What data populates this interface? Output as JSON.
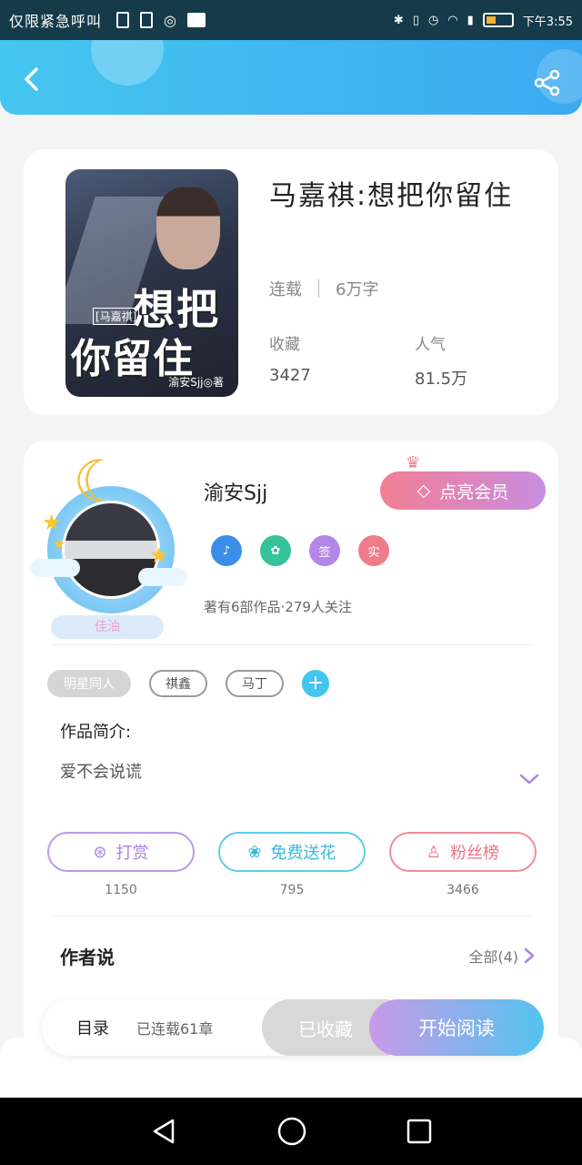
{
  "status_bar": {
    "carrier": "仅限紧急呼叫",
    "time": "下午3:55"
  },
  "header": {
    "back_icon": "chevron-left-icon",
    "share_icon": "share-icon"
  },
  "book": {
    "cover_title_line1": "想把",
    "cover_title_line2": "你留住",
    "cover_tag": "[马嘉祺]",
    "cover_author": "渝安Sjj◎著",
    "title": "马嘉祺:想把你留住",
    "status": "连载",
    "word_count": "6万字",
    "stats": [
      {
        "label": "收藏",
        "value": "3427"
      },
      {
        "label": "人气",
        "value": "81.5万"
      }
    ]
  },
  "author": {
    "name": "渝安Sjj",
    "avatar_badge": "佳油",
    "vip_label": "点亮会员",
    "badges": [
      {
        "icon": "music-note-icon",
        "color": "#3b8ee8",
        "text": "♪"
      },
      {
        "icon": "handshake-icon",
        "color": "#34c39a",
        "text": "✿"
      },
      {
        "icon": "sign-badge-icon",
        "color": "#b486e8",
        "text": "签"
      },
      {
        "icon": "verified-badge-icon",
        "color": "#f07c8a",
        "text": "实"
      }
    ],
    "info": "著有6部作品·279人关注"
  },
  "tags": [
    "明星同人",
    "祺鑫",
    "马丁"
  ],
  "intro": {
    "title": "作品简介:",
    "text": "爱不会说谎"
  },
  "actions": [
    {
      "label": "打赏",
      "icon": "yen-coin-icon",
      "count": "1150",
      "kind": "tip"
    },
    {
      "label": "免费送花",
      "icon": "flower-icon",
      "count": "795",
      "kind": "flower"
    },
    {
      "label": "粉丝榜",
      "icon": "fans-user-icon",
      "count": "3466",
      "kind": "fans"
    }
  ],
  "author_say": {
    "title": "作者说",
    "all_label": "全部(4)"
  },
  "bottom": {
    "toc": "目录",
    "toc_status": "已连载61章",
    "fav": "已收藏",
    "read": "开始阅读"
  },
  "colors": {
    "accent_blue": "#43c5ef",
    "accent_pink": "#f27e94",
    "accent_purple": "#c89ae8"
  }
}
